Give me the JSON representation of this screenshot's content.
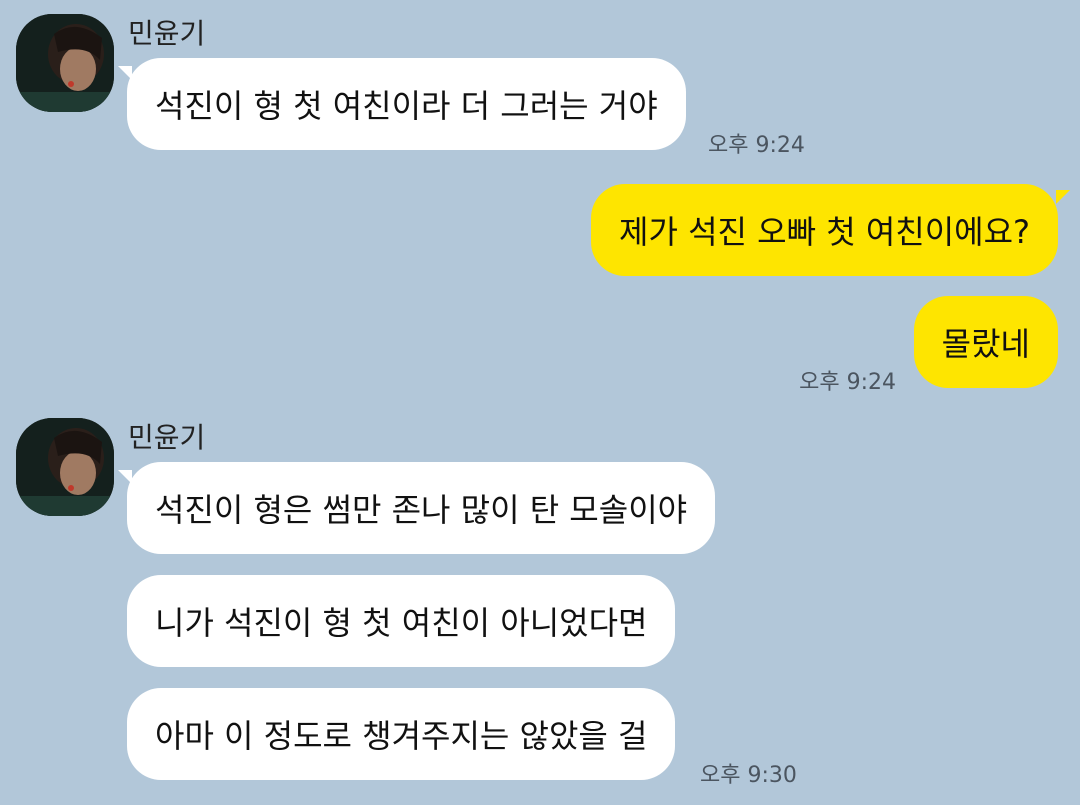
{
  "colors": {
    "background": "#b2c7d9",
    "incoming_bubble": "#ffffff",
    "outgoing_bubble": "#fee500",
    "timestamp_text": "#4b5560"
  },
  "messages": [
    {
      "sender": "민윤기",
      "direction": "incoming",
      "text": "석진이 형 첫 여친이라 더 그러는 거야",
      "time": "오후 9:24"
    },
    {
      "direction": "outgoing",
      "text": "제가 석진 오빠 첫 여친이에요?"
    },
    {
      "direction": "outgoing",
      "text": "몰랐네",
      "time": "오후 9:24"
    },
    {
      "sender": "민윤기",
      "direction": "incoming",
      "text": "석진이 형은 썸만 존나 많이 탄 모솔이야"
    },
    {
      "direction": "incoming",
      "text": "니가 석진이 형 첫 여친이 아니었다면"
    },
    {
      "direction": "incoming",
      "text": "아마 이 정도로 챙겨주지는 않았을 걸",
      "time": "오후 9:30"
    }
  ]
}
